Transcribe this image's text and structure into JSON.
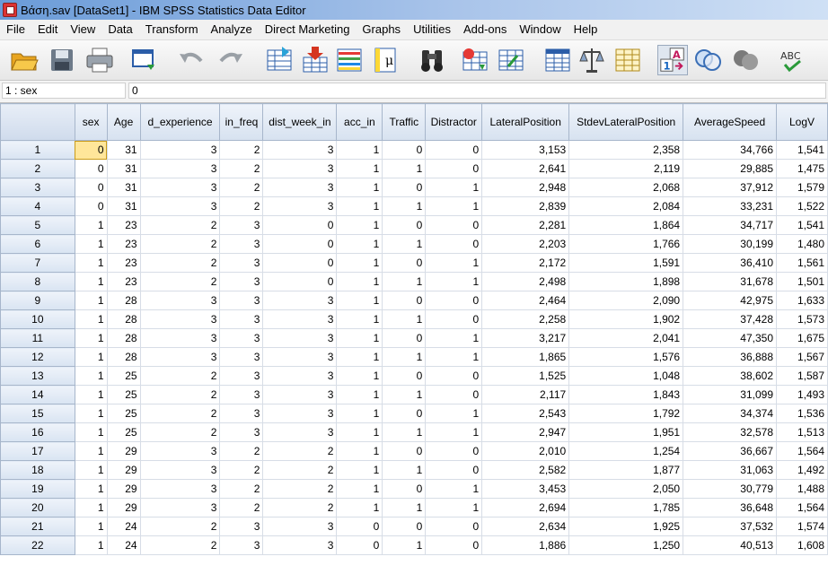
{
  "window": {
    "title": "Βάση.sav [DataSet1] - IBM SPSS Statistics Data Editor"
  },
  "menu": [
    "File",
    "Edit",
    "View",
    "Data",
    "Transform",
    "Analyze",
    "Direct Marketing",
    "Graphs",
    "Utilities",
    "Add-ons",
    "Window",
    "Help"
  ],
  "toolbar": [
    {
      "name": "open-icon"
    },
    {
      "name": "save-icon"
    },
    {
      "name": "print-icon"
    },
    {
      "name": "dialog-recall-icon"
    },
    {
      "name": "undo-icon"
    },
    {
      "name": "redo-icon"
    },
    {
      "name": "goto-case-icon"
    },
    {
      "name": "goto-variable-icon"
    },
    {
      "name": "variables-icon"
    },
    {
      "name": "find-icon"
    },
    {
      "name": "insert-cases-icon"
    },
    {
      "name": "insert-variable-icon"
    },
    {
      "name": "split-file-icon"
    },
    {
      "name": "weight-cases-icon"
    },
    {
      "name": "select-cases-icon"
    },
    {
      "name": "value-labels-icon"
    },
    {
      "name": "use-variable-sets-icon"
    },
    {
      "name": "show-all-variables-icon"
    },
    {
      "name": "spell-check-icon"
    }
  ],
  "cell_editor": {
    "reference": "1 : sex",
    "value": "0"
  },
  "columns": [
    "sex",
    "Age",
    "d_experience",
    "in_freq",
    "dist_week_in",
    "acc_in",
    "Traffic",
    "Distractor",
    "LateralPosition",
    "StdevLateralPosition",
    "AverageSpeed",
    "LogV"
  ],
  "rows": [
    {
      "n": "1",
      "v": [
        "0",
        "31",
        "3",
        "2",
        "3",
        "1",
        "0",
        "0",
        "3,153",
        "2,358",
        "34,766",
        "1,541"
      ]
    },
    {
      "n": "2",
      "v": [
        "0",
        "31",
        "3",
        "2",
        "3",
        "1",
        "1",
        "0",
        "2,641",
        "2,119",
        "29,885",
        "1,475"
      ]
    },
    {
      "n": "3",
      "v": [
        "0",
        "31",
        "3",
        "2",
        "3",
        "1",
        "0",
        "1",
        "2,948",
        "2,068",
        "37,912",
        "1,579"
      ]
    },
    {
      "n": "4",
      "v": [
        "0",
        "31",
        "3",
        "2",
        "3",
        "1",
        "1",
        "1",
        "2,839",
        "2,084",
        "33,231",
        "1,522"
      ]
    },
    {
      "n": "5",
      "v": [
        "1",
        "23",
        "2",
        "3",
        "0",
        "1",
        "0",
        "0",
        "2,281",
        "1,864",
        "34,717",
        "1,541"
      ]
    },
    {
      "n": "6",
      "v": [
        "1",
        "23",
        "2",
        "3",
        "0",
        "1",
        "1",
        "0",
        "2,203",
        "1,766",
        "30,199",
        "1,480"
      ]
    },
    {
      "n": "7",
      "v": [
        "1",
        "23",
        "2",
        "3",
        "0",
        "1",
        "0",
        "1",
        "2,172",
        "1,591",
        "36,410",
        "1,561"
      ]
    },
    {
      "n": "8",
      "v": [
        "1",
        "23",
        "2",
        "3",
        "0",
        "1",
        "1",
        "1",
        "2,498",
        "1,898",
        "31,678",
        "1,501"
      ]
    },
    {
      "n": "9",
      "v": [
        "1",
        "28",
        "3",
        "3",
        "3",
        "1",
        "0",
        "0",
        "2,464",
        "2,090",
        "42,975",
        "1,633"
      ]
    },
    {
      "n": "10",
      "v": [
        "1",
        "28",
        "3",
        "3",
        "3",
        "1",
        "1",
        "0",
        "2,258",
        "1,902",
        "37,428",
        "1,573"
      ]
    },
    {
      "n": "11",
      "v": [
        "1",
        "28",
        "3",
        "3",
        "3",
        "1",
        "0",
        "1",
        "3,217",
        "2,041",
        "47,350",
        "1,675"
      ]
    },
    {
      "n": "12",
      "v": [
        "1",
        "28",
        "3",
        "3",
        "3",
        "1",
        "1",
        "1",
        "1,865",
        "1,576",
        "36,888",
        "1,567"
      ]
    },
    {
      "n": "13",
      "v": [
        "1",
        "25",
        "2",
        "3",
        "3",
        "1",
        "0",
        "0",
        "1,525",
        "1,048",
        "38,602",
        "1,587"
      ]
    },
    {
      "n": "14",
      "v": [
        "1",
        "25",
        "2",
        "3",
        "3",
        "1",
        "1",
        "0",
        "2,117",
        "1,843",
        "31,099",
        "1,493"
      ]
    },
    {
      "n": "15",
      "v": [
        "1",
        "25",
        "2",
        "3",
        "3",
        "1",
        "0",
        "1",
        "2,543",
        "1,792",
        "34,374",
        "1,536"
      ]
    },
    {
      "n": "16",
      "v": [
        "1",
        "25",
        "2",
        "3",
        "3",
        "1",
        "1",
        "1",
        "2,947",
        "1,951",
        "32,578",
        "1,513"
      ]
    },
    {
      "n": "17",
      "v": [
        "1",
        "29",
        "3",
        "2",
        "2",
        "1",
        "0",
        "0",
        "2,010",
        "1,254",
        "36,667",
        "1,564"
      ]
    },
    {
      "n": "18",
      "v": [
        "1",
        "29",
        "3",
        "2",
        "2",
        "1",
        "1",
        "0",
        "2,582",
        "1,877",
        "31,063",
        "1,492"
      ]
    },
    {
      "n": "19",
      "v": [
        "1",
        "29",
        "3",
        "2",
        "2",
        "1",
        "0",
        "1",
        "3,453",
        "2,050",
        "30,779",
        "1,488"
      ]
    },
    {
      "n": "20",
      "v": [
        "1",
        "29",
        "3",
        "2",
        "2",
        "1",
        "1",
        "1",
        "2,694",
        "1,785",
        "36,648",
        "1,564"
      ]
    },
    {
      "n": "21",
      "v": [
        "1",
        "24",
        "2",
        "3",
        "3",
        "0",
        "0",
        "0",
        "2,634",
        "1,925",
        "37,532",
        "1,574"
      ]
    },
    {
      "n": "22",
      "v": [
        "1",
        "24",
        "2",
        "3",
        "3",
        "0",
        "1",
        "0",
        "1,886",
        "1,250",
        "40,513",
        "1,608"
      ]
    }
  ],
  "selected_cell": {
    "row": 0,
    "col": 0
  },
  "colors": {
    "selected_cell": "#ffe69a",
    "header": "#dce6f2",
    "title_bar": "#8fb2e3"
  }
}
